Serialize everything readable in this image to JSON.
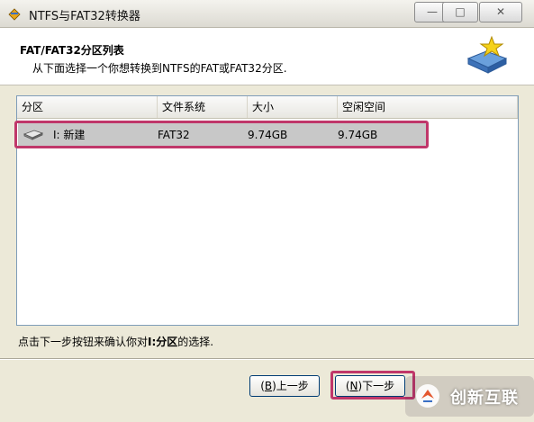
{
  "window": {
    "title": "NTFS与FAT32转换器",
    "controls": {
      "minimize": "—",
      "maximize": "□",
      "close": "✕"
    }
  },
  "header": {
    "title": "FAT/FAT32分区列表",
    "subtitle": "从下面选择一个你想转换到NTFS的FAT或FAT32分区."
  },
  "list": {
    "columns": [
      "分区",
      "文件系统",
      "大小",
      "空闲空间"
    ],
    "rows": [
      {
        "partition": "I: 新建",
        "filesystem": "FAT32",
        "size": "9.74GB",
        "free": "9.74GB",
        "selected": true
      }
    ]
  },
  "hint": {
    "prefix": "点击下一步按钮来确认你对",
    "bold": "I:分区",
    "suffix": "的选择."
  },
  "buttons": {
    "back": {
      "mnemonic": "B",
      "label": "上一步"
    },
    "next": {
      "mnemonic": "N",
      "label": "下一步"
    }
  },
  "watermark": {
    "text": "创新互联"
  },
  "colors": {
    "highlight": "#c0376a",
    "selected_row": "#c8c8c8"
  }
}
